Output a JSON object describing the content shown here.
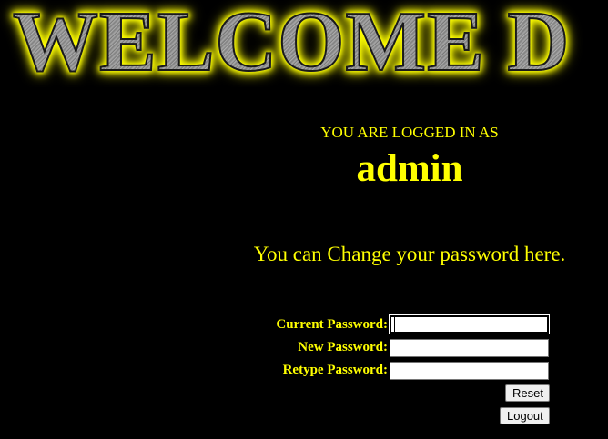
{
  "banner": {
    "title": "WELCOME D"
  },
  "session": {
    "logged_in_label": "YOU ARE LOGGED IN AS",
    "username": "admin"
  },
  "message": "You can Change your password here.",
  "form": {
    "current_password_label": "Current Password:",
    "new_password_label": "New Password:",
    "retype_password_label": "Retype Password:",
    "current_password_value": "",
    "new_password_value": "",
    "retype_password_value": "",
    "reset_label": "Reset",
    "logout_label": "Logout"
  }
}
